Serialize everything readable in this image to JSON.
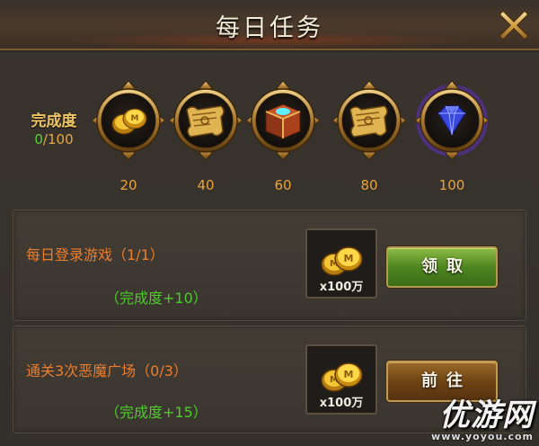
{
  "title": "每日任务",
  "progress": {
    "label": "完成度",
    "current": "0",
    "separator": "/",
    "max": "100"
  },
  "milestones": [
    {
      "icon": "gold-coins-icon",
      "threshold": "20"
    },
    {
      "icon": "scroll-icon",
      "threshold": "40"
    },
    {
      "icon": "treasure-chest-icon",
      "threshold": "60"
    },
    {
      "icon": "scroll-icon",
      "threshold": "80"
    },
    {
      "icon": "blue-diamond-icon",
      "threshold": "100"
    }
  ],
  "tasks": [
    {
      "name": "每日登录游戏（1/1）",
      "progress_reward": "（完成度+10）",
      "reward_icon": "gold-coins-icon",
      "reward_amount": "x100万",
      "button": "领取",
      "button_state": "claim"
    },
    {
      "name": "通关3次恶魔广场（0/3）",
      "progress_reward": "（完成度+15）",
      "reward_icon": "gold-coins-icon",
      "reward_amount": "x100万",
      "button": "前往",
      "button_state": "go"
    }
  ],
  "watermark": {
    "text": "优游网",
    "url": "www.yoyou.com"
  },
  "colors": {
    "accent_gold": "#e9a33a",
    "task_name": "#ec7e2e",
    "progress_green": "#4ecb2c",
    "claim_button": "#4f8621",
    "go_button": "#6f4414"
  }
}
